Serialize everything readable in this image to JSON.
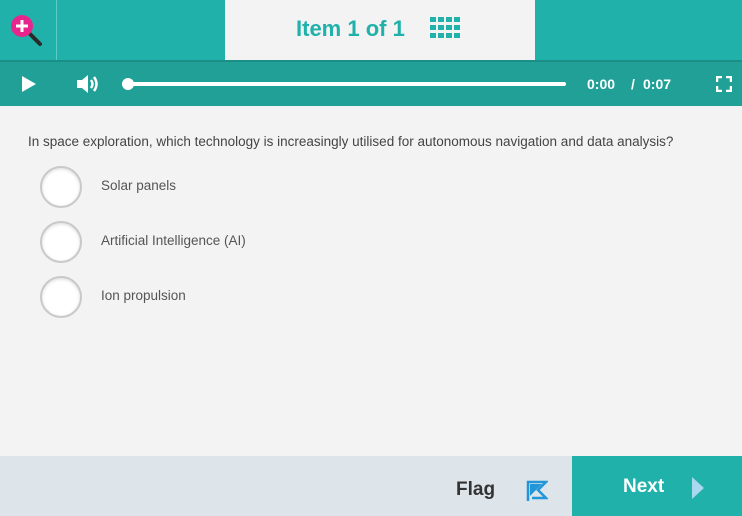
{
  "header": {
    "item_label": "Item 1 of 1",
    "icons": [
      "zoom-in-icon",
      "item-grid-icon"
    ],
    "colors": {
      "accent": "#20b2aa",
      "zoom_icon": "#e6268c"
    }
  },
  "media": {
    "current_time": "0:00",
    "separator": "/",
    "total_time": "0:07",
    "progress": 0,
    "icons": [
      "play-icon",
      "volume-icon",
      "fullscreen-icon"
    ]
  },
  "question": {
    "prompt": "In space exploration, which technology is increasingly utilised for autonomous navigation and data analysis?",
    "options": [
      {
        "label": "Solar panels",
        "selected": false
      },
      {
        "label": "Artificial Intelligence (AI)",
        "selected": false
      },
      {
        "label": "Ion propulsion",
        "selected": false
      }
    ]
  },
  "footer": {
    "flag_label": "Flag",
    "next_label": "Next",
    "icons": [
      "flag-icon",
      "next-arrow-icon"
    ]
  }
}
